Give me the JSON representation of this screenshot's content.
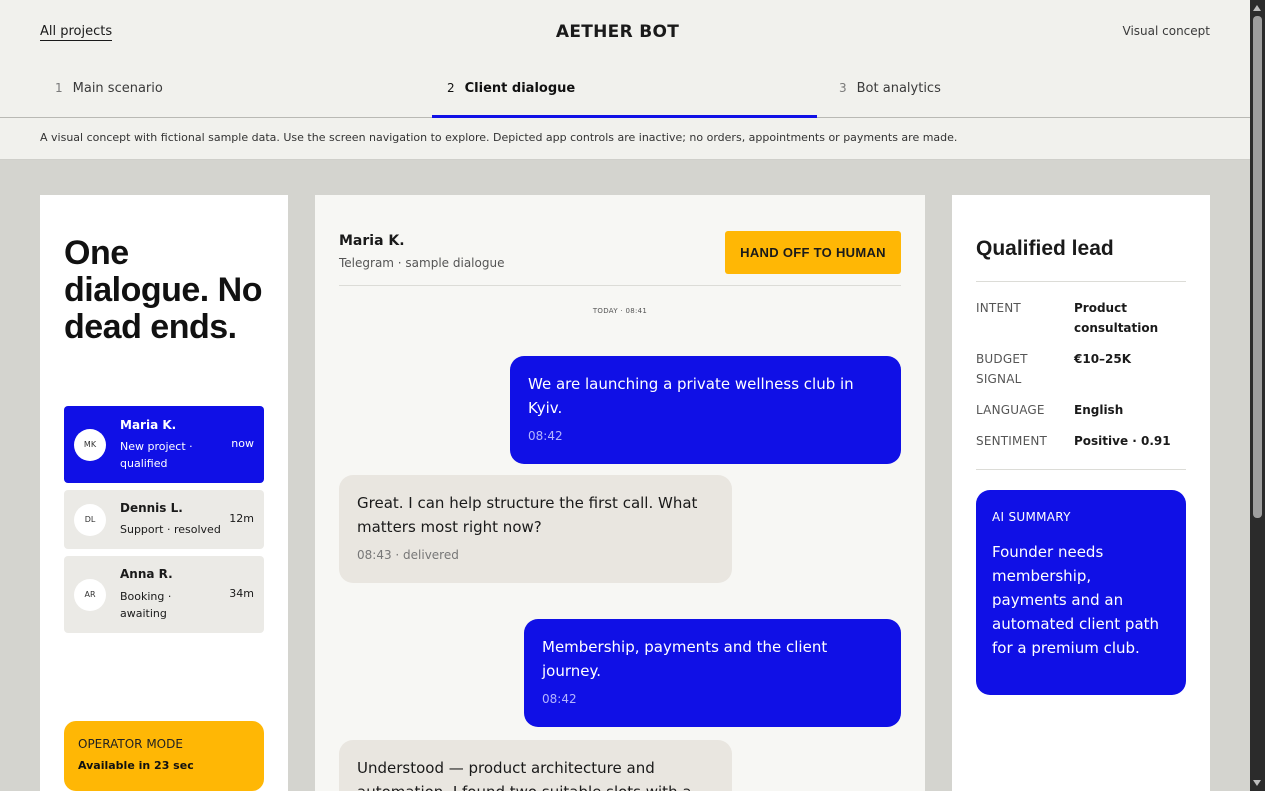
{
  "header": {
    "all_projects": "All projects",
    "title": "AETHER BOT",
    "visual_concept": "Visual concept"
  },
  "tabs": [
    {
      "num": "1",
      "label": "Main scenario",
      "active": false
    },
    {
      "num": "2",
      "label": "Client dialogue",
      "active": true
    },
    {
      "num": "3",
      "label": "Bot analytics",
      "active": false
    }
  ],
  "notice": "A visual concept with fictional sample data. Use the screen navigation to explore. Depicted app controls are inactive; no orders, appointments or payments are made.",
  "left": {
    "headline": "One dialogue. No dead ends.",
    "conversations": [
      {
        "initials": "MK",
        "name": "Maria K.",
        "sub": "New project · qualified",
        "time": "now",
        "active": true
      },
      {
        "initials": "DL",
        "name": "Dennis L.",
        "sub": "Support · resolved",
        "time": "12m",
        "active": false
      },
      {
        "initials": "AR",
        "name": "Anna R.",
        "sub": "Booking · awaiting",
        "time": "34m",
        "active": false
      }
    ],
    "operator": {
      "label": "OPERATOR MODE",
      "status": "Available in 23 sec"
    }
  },
  "chat": {
    "contact": "Maria K.",
    "channel": "Telegram · sample dialogue",
    "handoff_label": "HAND OFF TO HUMAN",
    "date_label": "TODAY · 08:41",
    "messages": [
      {
        "dir": "out",
        "text": "We are launching a private wellness club in Kyiv.",
        "meta": "08:42"
      },
      {
        "dir": "in",
        "text": "Great. I can help structure the first call. What matters most right now?",
        "meta": "08:43 · delivered"
      },
      {
        "dir": "out",
        "text": "Membership, payments and the client journey.",
        "meta": "08:42"
      },
      {
        "dir": "in",
        "text": "Understood — product architecture and automation. I found two suitable slots with a",
        "meta": ""
      }
    ]
  },
  "lead": {
    "title": "Qualified lead",
    "fields": [
      {
        "key": "INTENT",
        "value": "Product consultation"
      },
      {
        "key": "BUDGET SIGNAL",
        "value": "€10–25K"
      },
      {
        "key": "LANGUAGE",
        "value": "English"
      },
      {
        "key": "SENTIMENT",
        "value": "Positive · 0.91"
      }
    ],
    "summary_heading": "AI SUMMARY",
    "summary_text": "Founder needs membership, payments and an automated client path for a premium club."
  },
  "colors": {
    "accent_blue": "#1010e6",
    "accent_yellow": "#ffb705",
    "page_bg": "#f1f1ed"
  }
}
